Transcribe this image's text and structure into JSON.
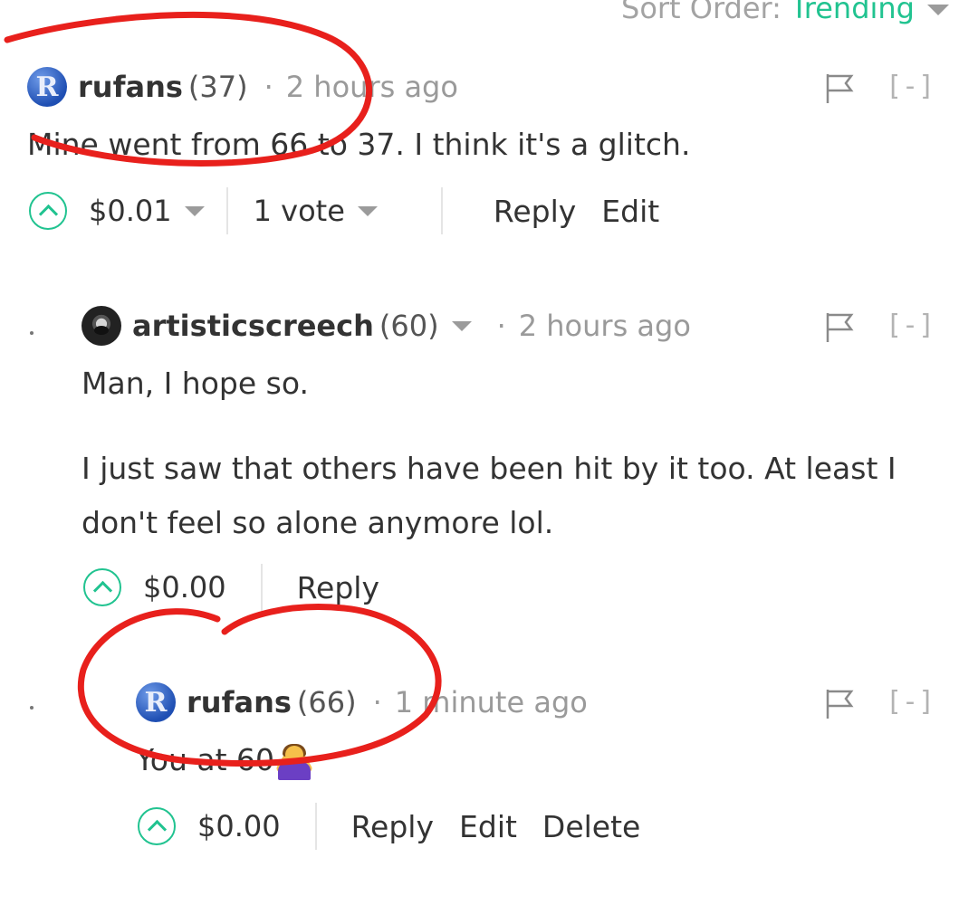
{
  "sort": {
    "label": "Sort Order:",
    "value": "Trending"
  },
  "comments": [
    {
      "author": "rufans",
      "reputation": "(37)",
      "separator": "·",
      "time": "2 hours ago",
      "body": "Mine went from 66 to 37. I think it's a glitch.",
      "payout": "$0.01",
      "votes": "1 vote",
      "actions": [
        "Reply",
        "Edit"
      ],
      "collapse": "[-]"
    },
    {
      "author": "artisticscreech",
      "reputation": "(60)",
      "separator": "·",
      "time": "2 hours ago",
      "body_paragraphs": [
        "Man, I hope so.",
        "I just saw that others have been hit by it too. At least I don't feel so alone anymore lol."
      ],
      "payout": "$0.00",
      "actions": [
        "Reply"
      ],
      "collapse": "[-]"
    },
    {
      "author": "rufans",
      "reputation": "(66)",
      "separator": "·",
      "time": "1 minute ago",
      "body": "You at 60",
      "payout": "$0.00",
      "actions": [
        "Reply",
        "Edit",
        "Delete"
      ],
      "collapse": "[-]"
    }
  ],
  "colors": {
    "accent": "#21c390",
    "annotation": "#e8201c",
    "muted": "#9a9a9a"
  },
  "avatar_letter": "R"
}
